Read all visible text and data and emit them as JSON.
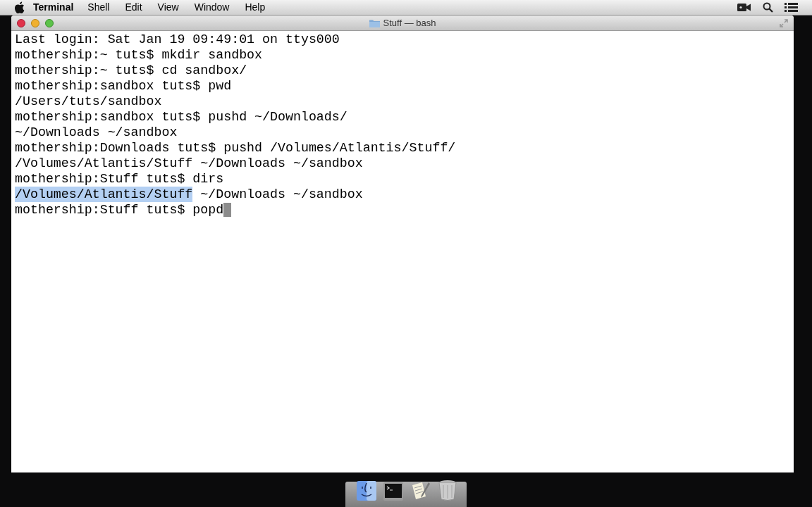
{
  "menu_bar": {
    "app_name": "Terminal",
    "menus": [
      "Shell",
      "Edit",
      "View",
      "Window",
      "Help"
    ]
  },
  "window": {
    "title": "Stuff — bash"
  },
  "terminal": {
    "lines": [
      {
        "segments": [
          {
            "text": "Last login: Sat Jan 19 09:49:01 on ttys000",
            "selected": false
          }
        ],
        "cursor": false
      },
      {
        "segments": [
          {
            "text": "mothership:~ tuts$ mkdir sandbox",
            "selected": false
          }
        ],
        "cursor": false
      },
      {
        "segments": [
          {
            "text": "mothership:~ tuts$ cd sandbox/",
            "selected": false
          }
        ],
        "cursor": false
      },
      {
        "segments": [
          {
            "text": "mothership:sandbox tuts$ pwd",
            "selected": false
          }
        ],
        "cursor": false
      },
      {
        "segments": [
          {
            "text": "/Users/tuts/sandbox",
            "selected": false
          }
        ],
        "cursor": false
      },
      {
        "segments": [
          {
            "text": "mothership:sandbox tuts$ pushd ~/Downloads/",
            "selected": false
          }
        ],
        "cursor": false
      },
      {
        "segments": [
          {
            "text": "~/Downloads ~/sandbox",
            "selected": false
          }
        ],
        "cursor": false
      },
      {
        "segments": [
          {
            "text": "mothership:Downloads tuts$ pushd /Volumes/Atlantis/Stuff/",
            "selected": false
          }
        ],
        "cursor": false
      },
      {
        "segments": [
          {
            "text": "/Volumes/Atlantis/Stuff ~/Downloads ~/sandbox",
            "selected": false
          }
        ],
        "cursor": false
      },
      {
        "segments": [
          {
            "text": "mothership:Stuff tuts$ dirs",
            "selected": false
          }
        ],
        "cursor": false
      },
      {
        "segments": [
          {
            "text": "/Volumes/Atlantis/Stuff",
            "selected": true
          },
          {
            "text": " ~/Downloads ~/sandbox",
            "selected": false
          }
        ],
        "cursor": false
      },
      {
        "segments": [
          {
            "text": "mothership:Stuff tuts$ popd",
            "selected": false
          }
        ],
        "cursor": true
      }
    ]
  }
}
